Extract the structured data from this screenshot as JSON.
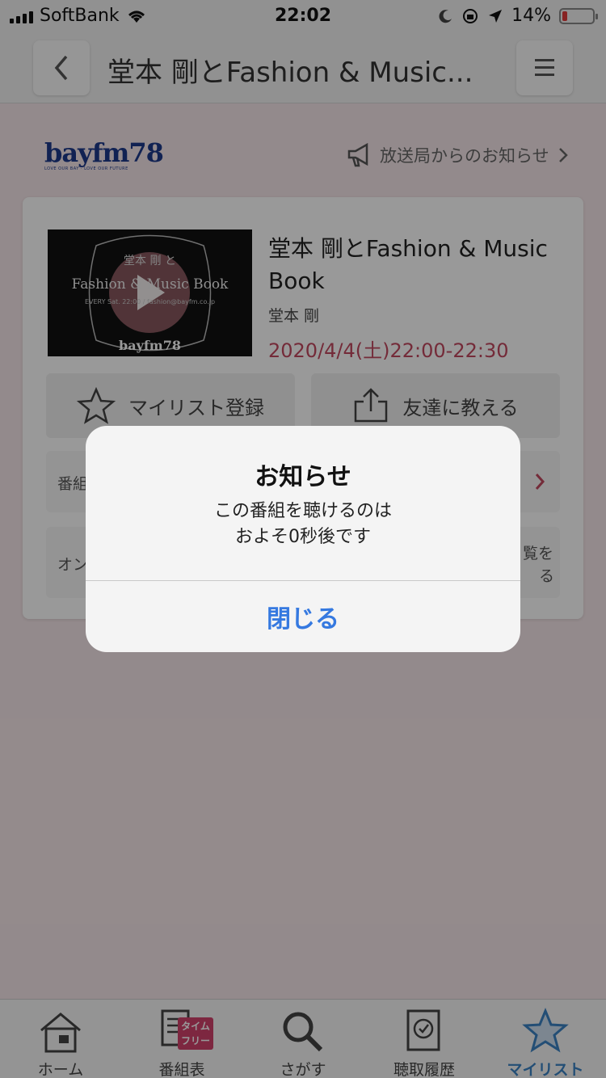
{
  "status": {
    "carrier": "SoftBank",
    "time": "22:02",
    "battery": "14%",
    "battery_level": 0.14
  },
  "header": {
    "title": "堂本 剛とFashion & Music...",
    "back_icon": "chevron-left-icon",
    "menu_icon": "hamburger-icon"
  },
  "station": {
    "logo_text": "bayfm78",
    "logo_sub": "LOVE OUR BAY · LOVE OUR FUTURE",
    "notice_link": "放送局からのお知らせ"
  },
  "program": {
    "title": "堂本 剛とFashion & Music Book",
    "host": "堂本 剛",
    "time": "2020/4/4(土)22:00-22:30",
    "thumb": {
      "line1": "堂本 剛 と",
      "line2": "Fashion & Music Book",
      "line3": "EVERY Sat. 22:00 / fashion@bayfm.co.jp",
      "brand": "bayfm78"
    }
  },
  "actions": {
    "mylist": "マイリスト登録",
    "share": "友達に教える"
  },
  "rows": {
    "row1_label": "番組",
    "row2_left": "オン",
    "row2_right_line1": "覧を",
    "row2_right_line2": "る"
  },
  "alert": {
    "title": "お知らせ",
    "message_line1": "この番組を聴けるのは",
    "message_line2": "およそ0秒後です",
    "button": "閉じる"
  },
  "tabs": [
    {
      "label": "ホーム",
      "icon": "home-icon"
    },
    {
      "label": "番組表",
      "icon": "program-guide-icon",
      "badge": "タイム\nフリー"
    },
    {
      "label": "さがす",
      "icon": "search-icon"
    },
    {
      "label": "聴取履歴",
      "icon": "history-icon"
    },
    {
      "label": "マイリスト",
      "icon": "star-icon",
      "active": true
    }
  ],
  "colors": {
    "accent": "#3b82c4",
    "time_pink": "#c2485f",
    "alert_button": "#3579e0"
  }
}
